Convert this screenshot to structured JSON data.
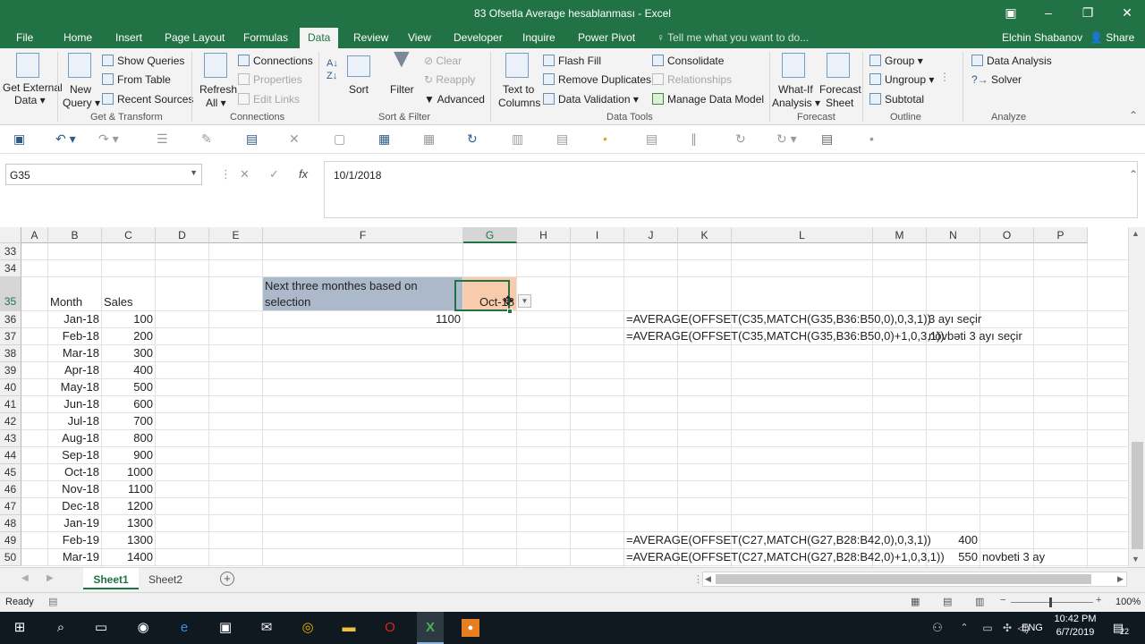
{
  "window": {
    "title": "83 Ofsetla Average hesablanması - Excel",
    "restore_icon": "restore-icon",
    "min": "–",
    "max": "❐",
    "close": "✕"
  },
  "tabs": [
    "File",
    "Home",
    "Insert",
    "Page Layout",
    "Formulas",
    "Data",
    "Review",
    "View",
    "Developer",
    "Inquire",
    "Power Pivot"
  ],
  "tell_me": "Tell me what you want to do...",
  "user": "Elchin Shabanov",
  "share": "Share",
  "ribbon": {
    "get_external": "Get External",
    "get_external2": "Data ▾",
    "new_query": "New",
    "new_query2": "Query ▾",
    "show_queries": "Show Queries",
    "from_table": "From Table",
    "recent_sources": "Recent Sources",
    "refresh": "Refresh",
    "refresh2": "All ▾",
    "connections": "Connections",
    "properties": "Properties",
    "edit_links": "Edit Links",
    "sort": "Sort",
    "filter": "Filter",
    "clear": "Clear",
    "reapply": "Reapply",
    "advanced": "Advanced",
    "text_to": "Text to",
    "columns": "Columns",
    "flash_fill": "Flash Fill",
    "remove_dup": "Remove Duplicates",
    "data_validation": "Data Validation",
    "consolidate": "Consolidate",
    "relationships": "Relationships",
    "manage_model": "Manage Data Model",
    "whatif": "What-If",
    "analysis": "Analysis ▾",
    "forecast": "Forecast",
    "sheet": "Sheet",
    "group": "Group",
    "ungroup": "Ungroup",
    "subtotal": "Subtotal",
    "data_analysis": "Data Analysis",
    "solver": "Solver",
    "grp_getx": "Get & Transform",
    "grp_conn": "Connections",
    "grp_sort": "Sort & Filter",
    "grp_tools": "Data Tools",
    "grp_fc": "Forecast",
    "grp_outline": "Outline",
    "grp_an": "Analyze"
  },
  "formula_bar": {
    "name_box": "G35",
    "value": "10/1/2018",
    "fx": "fx",
    "cancel": "✕",
    "enter": "✓"
  },
  "columns": [
    "A",
    "B",
    "C",
    "D",
    "E",
    "F",
    "G",
    "H",
    "I",
    "J",
    "K",
    "L",
    "M",
    "N",
    "O",
    "P"
  ],
  "rows": [
    "33",
    "34",
    "35",
    "36",
    "37",
    "38",
    "39",
    "40",
    "41",
    "42",
    "43",
    "44",
    "45",
    "46",
    "47",
    "48",
    "49",
    "50"
  ],
  "cells": {
    "B35": "Month",
    "C35": "Sales",
    "F35": "Next three monthes based on selection",
    "G35": "Oct-18",
    "F36": "1100",
    "J36": "=AVERAGE(OFFSET(C35,MATCH(G35,B36:B50,0),0,3,1))",
    "N36": "3 ayı seçir",
    "J37": "=AVERAGE(OFFSET(C35,MATCH(G35,B36:B50,0)+1,0,3,1))",
    "N37": "növbəti 3 ayı seçir",
    "J49": "=AVERAGE(OFFSET(C27,MATCH(G27,B28:B42,0),0,3,1))",
    "N49": "400",
    "J50": "=AVERAGE(OFFSET(C27,MATCH(G27,B28:B42,0)+1,0,3,1))",
    "N50": "550",
    "O50": "novbeti 3 ay"
  },
  "months": [
    "Jan-18",
    "Feb-18",
    "Mar-18",
    "Apr-18",
    "May-18",
    "Jun-18",
    "Jul-18",
    "Aug-18",
    "Sep-18",
    "Oct-18",
    "Nov-18",
    "Dec-18",
    "Jan-19",
    "Feb-19",
    "Mar-19"
  ],
  "sales": [
    "100",
    "200",
    "300",
    "400",
    "500",
    "600",
    "700",
    "800",
    "900",
    "1000",
    "1100",
    "1200",
    "1300",
    "1300",
    "1400"
  ],
  "sheets": [
    "Sheet1",
    "Sheet2"
  ],
  "status": {
    "ready": "Ready",
    "zoom": "100%"
  },
  "taskbar": {
    "lang": "ENG",
    "time": "10:42 PM",
    "date": "6/7/2019",
    "notif": "22"
  },
  "colors": {
    "excel_green": "#217346",
    "selection_fill": "#f8cbad",
    "label_fill": "#acb9ca"
  }
}
